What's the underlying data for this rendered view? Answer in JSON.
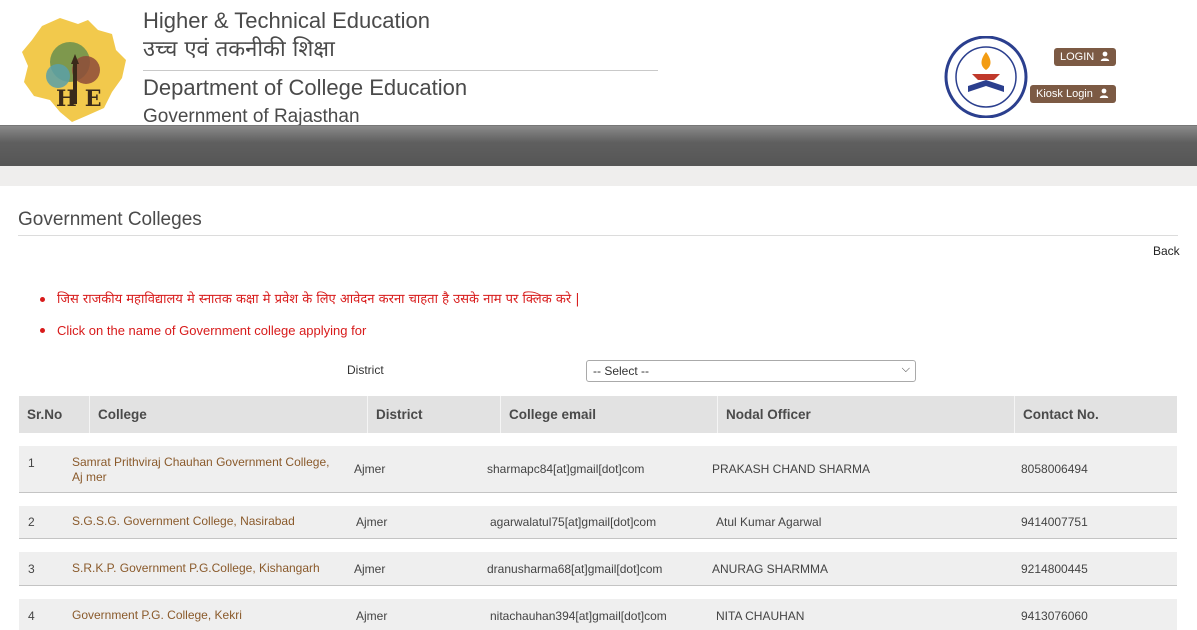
{
  "header": {
    "title_en": "Higher & Technical Education",
    "title_hi": "उच्च एवं तकनीकी शिक्षा",
    "department": "Department of College Education",
    "government": "Government of Rajasthan",
    "logo_letters": "HE",
    "login_label": "LOGIN",
    "kiosk_label": "Kiosk Login"
  },
  "page": {
    "title": "Government Colleges",
    "back_label": "Back",
    "notes": [
      "जिस राजकीय महाविद्यालय मे स्नातक कक्षा मे प्रवेश के लिए आवेदन करना चाहता है उसके नाम पर क्लिक करे |",
      "Click on the name of Government college applying for"
    ]
  },
  "filter": {
    "district_label": "District",
    "district_value": "-- Select --"
  },
  "table": {
    "headers": [
      "Sr.No",
      "College",
      "District",
      "College email",
      "Nodal Officer",
      "Contact No."
    ],
    "rows": [
      {
        "sr": "1",
        "college": "Samrat Prithviraj Chauhan Government College, Aj mer",
        "district": "Ajmer",
        "email": "sharmapc84[at]gmail[dot]com",
        "officer": "PRAKASH CHAND SHARMA",
        "contact": "8058006494"
      },
      {
        "sr": "2",
        "college": "S.G.S.G. Government College, Nasirabad",
        "district": "Ajmer",
        "email": "agarwalatul75[at]gmail[dot]com",
        "officer": "Atul Kumar Agarwal",
        "contact": "9414007751"
      },
      {
        "sr": "3",
        "college": "S.R.K.P. Government P.G.College, Kishangarh",
        "district": "Ajmer",
        "email": "dranusharma68[at]gmail[dot]com",
        "officer": "ANURAG SHARMMA",
        "contact": "9214800445"
      },
      {
        "sr": "4",
        "college": "Government P.G. College, Kekri",
        "district": "Ajmer",
        "email": "nitachauhan394[at]gmail[dot]com",
        "officer": "NITA CHAUHAN",
        "contact": "9413076060"
      }
    ]
  },
  "colors": {
    "brand_brown": "#7c5a44",
    "note_red": "#d81b1b",
    "college_link": "#8a5a2b",
    "navbar": "#5f5f5f"
  },
  "icons": {
    "user": "user-icon",
    "chevron": "chevron-down-icon"
  }
}
